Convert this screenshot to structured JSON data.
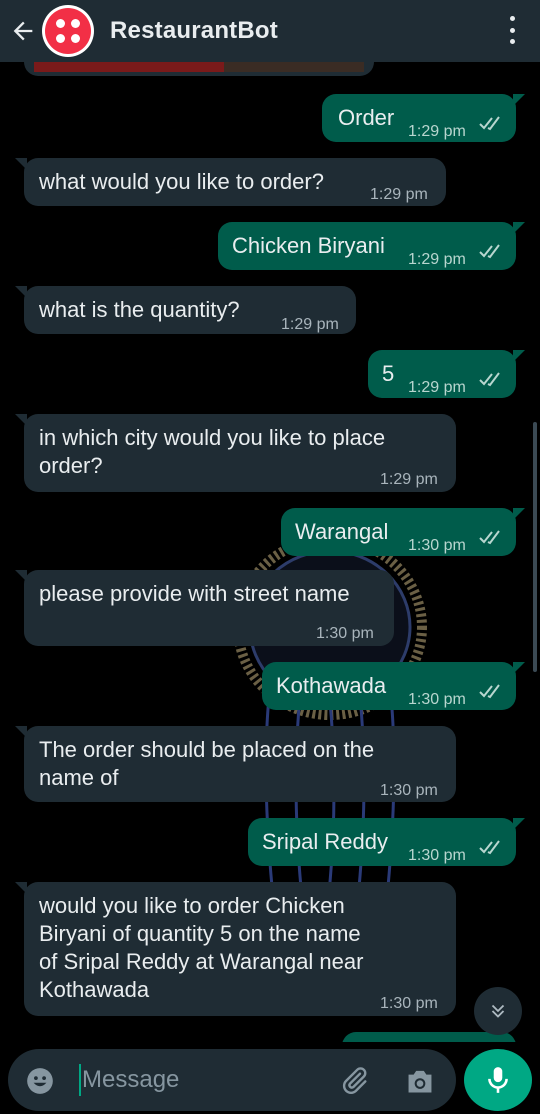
{
  "header": {
    "title": "RestaurantBot"
  },
  "messages": [
    {
      "dir": "out",
      "text": "Order",
      "time": "1:29 pm"
    },
    {
      "dir": "in",
      "text": "what would you like to order?",
      "time": "1:29 pm"
    },
    {
      "dir": "out",
      "text": "Chicken Biryani",
      "time": "1:29 pm"
    },
    {
      "dir": "in",
      "text": "what is the quantity?",
      "time": "1:29 pm"
    },
    {
      "dir": "out",
      "text": "5",
      "time": "1:29 pm"
    },
    {
      "dir": "in",
      "text": "in which city would you like to place\norder?",
      "time": "1:29 pm"
    },
    {
      "dir": "out",
      "text": "Warangal",
      "time": "1:30 pm"
    },
    {
      "dir": "in",
      "text": "please provide with street name",
      "time": "1:30 pm"
    },
    {
      "dir": "out",
      "text": "Kothawada",
      "time": "1:30 pm"
    },
    {
      "dir": "in",
      "text": "The order should be placed on the\nname of",
      "time": "1:30 pm"
    },
    {
      "dir": "out",
      "text": "Sripal Reddy",
      "time": "1:30 pm"
    },
    {
      "dir": "in",
      "text": "would you like to order Chicken\nBiryani of quantity 5 on the name\nof Sripal Reddy at Warangal near\nKothawada",
      "time": "1:30 pm"
    }
  ],
  "composer": {
    "placeholder": "Message"
  },
  "colors": {
    "header": "#1f2c34",
    "incoming": "#1f2c34",
    "outgoing": "#005c4b",
    "accent": "#00a884"
  },
  "icons": [
    "back-arrow-icon",
    "twilio-logo-icon",
    "more-vert-icon",
    "double-check-icon",
    "scroll-down-icon",
    "emoji-icon",
    "attach-icon",
    "camera-icon",
    "mic-icon"
  ]
}
